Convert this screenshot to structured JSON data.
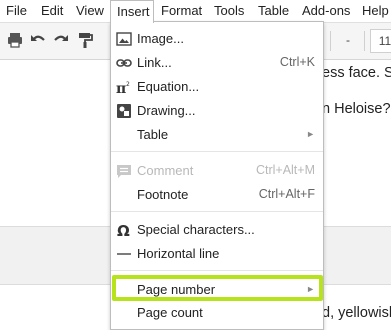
{
  "menubar": {
    "items": [
      "File",
      "Edit",
      "View",
      "Insert",
      "Format",
      "Tools",
      "Table",
      "Add-ons",
      "Help"
    ]
  },
  "toolbar": {
    "font_size": "11",
    "dropdown_glyph": "-"
  },
  "document": {
    "lines": [
      "ess face. S",
      "n Heloise?\"",
      "d, yellowish"
    ]
  },
  "insert_menu": {
    "items": [
      {
        "label": "Image...",
        "icon": "image-icon",
        "shortcut": "",
        "submenu": false,
        "disabled": false
      },
      {
        "label": "Link...",
        "icon": "link-icon",
        "shortcut": "Ctrl+K",
        "submenu": false,
        "disabled": false
      },
      {
        "label": "Equation...",
        "icon": "pi-icon",
        "shortcut": "",
        "submenu": false,
        "disabled": false
      },
      {
        "label": "Drawing...",
        "icon": "drawing-icon",
        "shortcut": "",
        "submenu": false,
        "disabled": false
      },
      {
        "label": "Table",
        "icon": "",
        "shortcut": "",
        "submenu": true,
        "disabled": false
      },
      {
        "label": "Comment",
        "icon": "comment-icon",
        "shortcut": "Ctrl+Alt+M",
        "submenu": false,
        "disabled": true
      },
      {
        "label": "Footnote",
        "icon": "",
        "shortcut": "Ctrl+Alt+F",
        "submenu": false,
        "disabled": false
      },
      {
        "label": "Special characters...",
        "icon": "omega-icon",
        "shortcut": "",
        "submenu": false,
        "disabled": false
      },
      {
        "label": "Horizontal line",
        "icon": "horizontal-line-icon",
        "shortcut": "",
        "submenu": false,
        "disabled": false
      },
      {
        "label": "Page number",
        "icon": "",
        "shortcut": "",
        "submenu": true,
        "disabled": false
      },
      {
        "label": "Page count",
        "icon": "",
        "shortcut": "",
        "submenu": false,
        "disabled": false
      }
    ]
  },
  "colors": {
    "highlight": "#b7e31c"
  }
}
